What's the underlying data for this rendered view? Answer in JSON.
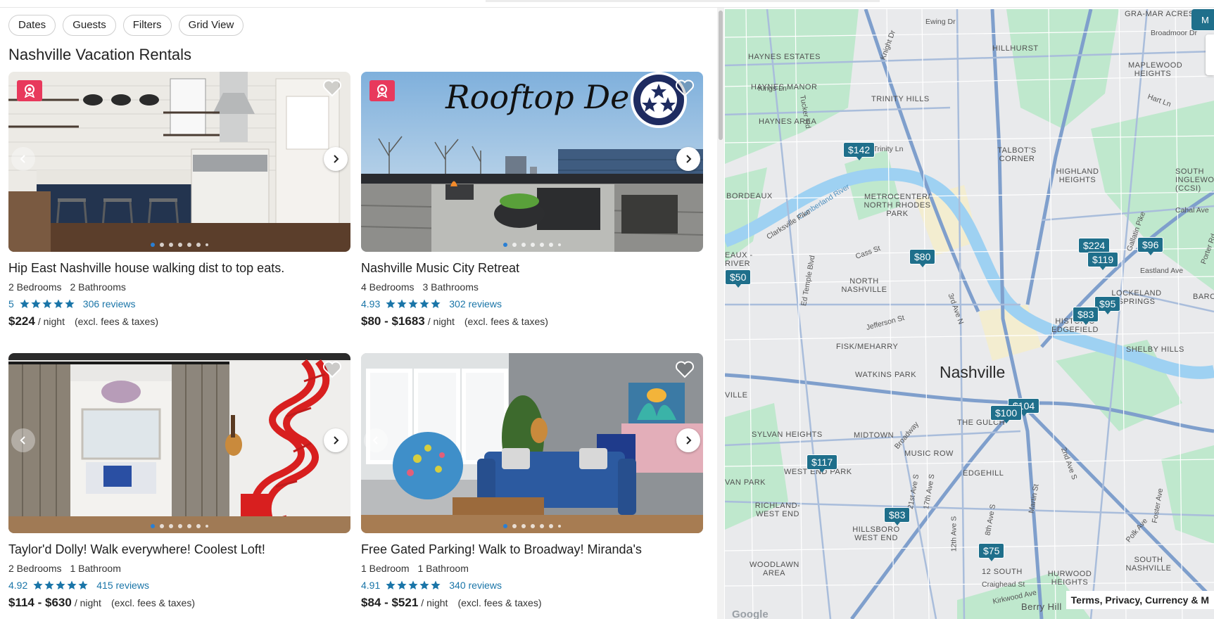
{
  "filters": [
    "Dates",
    "Guests",
    "Filters",
    "Grid View"
  ],
  "page_title": "Nashville Vacation Rentals",
  "listings": [
    {
      "name": "Hip East Nashville house walking dist to top eats.",
      "bedrooms": "2 Bedrooms",
      "bathrooms": "2 Bathrooms",
      "rating": "5",
      "reviews": "306 reviews",
      "price": "$224",
      "per_night": "/ night",
      "excl": "(excl. fees & taxes)",
      "badge": "award-badge-icon"
    },
    {
      "name": "Nashville Music City Retreat",
      "bedrooms": "4 Bedrooms",
      "bathrooms": "3 Bathrooms",
      "rating": "4.93",
      "reviews": "302 reviews",
      "price": "$80 - $1683",
      "per_night": "/ night",
      "excl": "(excl. fees & taxes)",
      "photo_caption": "Rooftop Deck",
      "badge": "award-badge-icon"
    },
    {
      "name": "Taylor'd Dolly! Walk everywhere! Coolest Loft!",
      "bedrooms": "2 Bedrooms",
      "bathrooms": "1 Bathroom",
      "rating": "4.92",
      "reviews": "415 reviews",
      "price": "$114 - $630",
      "per_night": "/ night",
      "excl": "(excl. fees & taxes)"
    },
    {
      "name": "Free Gated Parking! Walk to Broadway! Miranda's",
      "bedrooms": "1 Bedroom",
      "bathrooms": "1 Bathroom",
      "rating": "4.91",
      "reviews": "340 reviews",
      "price": "$84 - $521",
      "per_night": "/ night",
      "excl": "(excl. fees & taxes)"
    }
  ],
  "map": {
    "city": "Nashville",
    "pins": [
      "$142",
      "$80",
      "$224",
      "$119",
      "$96",
      "$95",
      "$83",
      "$104",
      "$100",
      "$117",
      "$83",
      "$75",
      "$50"
    ],
    "areas": [
      "HAYNES ESTATES",
      "HAYNES MANOR",
      "HAYNES AREA",
      "TRINITY HILLS",
      "HILLHURST",
      "GRA-MAR ACRES",
      "MAPLEWOOD HEIGHTS",
      "TALBOT'S CORNER",
      "HIGHLAND HEIGHTS",
      "SOUTH INGLEWOOD (CCSI)",
      "BORDEAUX",
      "METROCENTER/ NORTH RHODES PARK",
      "NORTH NASHVILLE",
      "EAUX -RIVER",
      "LOCKELAND SPRINGS",
      "BARCLA",
      "HISTORIC EDGEFIELD",
      "SHELBY HILLS",
      "FISK/MEHARRY",
      "WATKINS PARK",
      "THE GULCH",
      "SYLVAN HEIGHTS",
      "MIDTOWN",
      "MUSIC ROW",
      "EDGEHILL",
      "WEST END PARK",
      "VAN PARK",
      "RICHLAND-WEST END",
      "HILLSBORO WEST END",
      "WOODLAWN AREA",
      "12 SOUTH",
      "HURWOOD HEIGHTS",
      "SOUTH NASHVILLE",
      "VILLE",
      "Berry Hill"
    ],
    "streets": [
      "Ewing Dr",
      "Kings Ln",
      "W Trinity Ln",
      "Cumberland River",
      "Clarksville Pike",
      "Cass St",
      "Jefferson St",
      "Ed Temple Blvd",
      "3rd Ave N",
      "Gallatin Pike",
      "Cahal Ave",
      "Eastland Ave",
      "Hart Ln",
      "Broadmoor Dr",
      "Porter Rd",
      "Broadway",
      "21st Ave S",
      "12th Ave S",
      "Martin St",
      "2nd Ave S",
      "Craighead St",
      "Kirkwood Ave",
      "Polk Ave",
      "Foster Ave",
      "Tucker Rd",
      "Knight Dr",
      "17th Ave S",
      "8th Ave S"
    ],
    "terms": "Terms, Privacy, Currency & M",
    "attribution": "Google"
  }
}
